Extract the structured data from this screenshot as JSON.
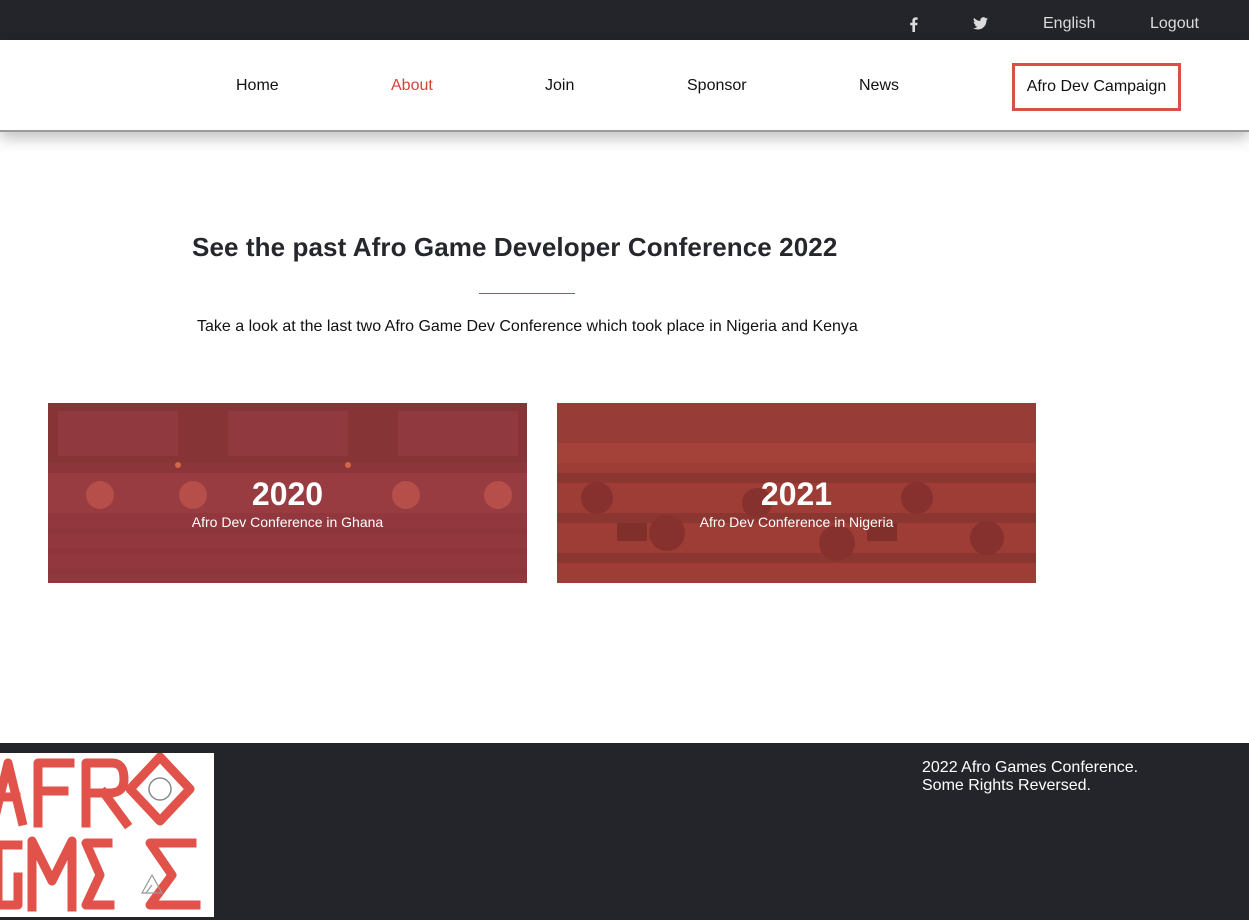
{
  "topbar": {
    "facebook_icon": "facebook-icon",
    "twitter_icon": "twitter-icon",
    "language": "English",
    "logout": "Logout"
  },
  "nav": {
    "items": [
      {
        "label": "Home",
        "active": false
      },
      {
        "label": "About",
        "active": true
      },
      {
        "label": "Join",
        "active": false
      },
      {
        "label": "Sponsor",
        "active": false
      },
      {
        "label": "News",
        "active": false
      }
    ],
    "campaign_button": "Afro Dev Campaign",
    "accent_color": "#d9413a"
  },
  "main": {
    "headline": "See the past Afro Game Developer Conference 2022",
    "subtext": "Take a look at the last two Afro Game Dev Conference which took place in Nigeria and Kenya",
    "cards": [
      {
        "year": "2020",
        "caption": "Afro Dev Conference in Ghana"
      },
      {
        "year": "2021",
        "caption": "Afro Dev Conference in Nigeria"
      }
    ]
  },
  "footer": {
    "copyright_line1": "2022 Afro Games Conference.",
    "copyright_line2": "Some Rights Reversed.",
    "logo_text": "AFRO GAMES"
  },
  "colors": {
    "dark_bar": "#24252b",
    "card_tint": "#be3e37",
    "logo_red": "#e0524a"
  }
}
